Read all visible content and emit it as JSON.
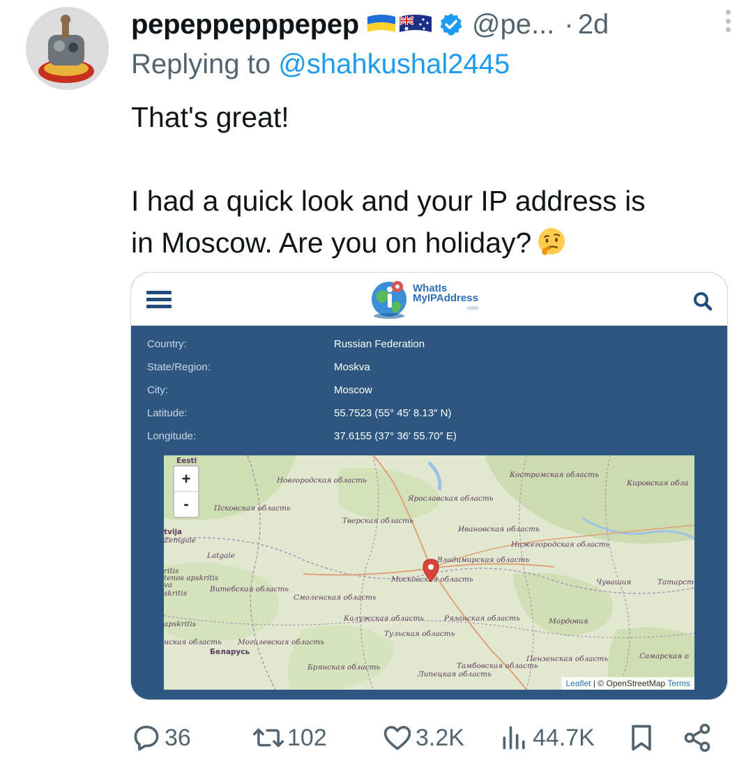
{
  "tweet": {
    "display_name": "pepeppepppepep",
    "handle": "@pe...",
    "separator": "·",
    "time": "2d",
    "replying_prefix": "Replying to ",
    "replying_to": "@shahkushal2445",
    "text_line1": "That's great!",
    "text_line2": "I had a quick look and your IP address is",
    "text_line3": "in Moscow. Are you on holiday?",
    "emoji": "thinking-face"
  },
  "card": {
    "logo_line1": "WhatIs",
    "logo_line2": "MyIPAddress",
    "logo_line3": ".com",
    "rows": [
      {
        "key": "Country:",
        "value": "Russian Federation"
      },
      {
        "key": "State/Region:",
        "value": "Moskva"
      },
      {
        "key": "City:",
        "value": "Moscow"
      },
      {
        "key": "Latitude:",
        "value": "55.7523 (55° 45′ 8.13″ N)"
      },
      {
        "key": "Longitude:",
        "value": "37.6155 (37° 36′ 55.70″ E)"
      }
    ],
    "map": {
      "zoom_in": "+",
      "zoom_out": "-",
      "labels": {
        "eesti": "Eesti",
        "novgorod": "Новгородская область",
        "kostroma": "Костромская область",
        "kirov": "Кировская обла",
        "yaroslavl": "Ярославская область",
        "pskov": "Псковская область",
        "tver": "Тверская область",
        "ivanovo": "Ивановская область",
        "nizhny": "Нижегородская область",
        "latvija": "tvija",
        "zemgale": "Zemgale",
        "latgale": "Latgale",
        "vladimir": "Владимирская область",
        "moscow_obl": "Московская область",
        "chuvash": "Чувашия",
        "tatar": "Татарст",
        "vitebsk": "Витебская область",
        "smolensk": "Смоленская область",
        "kaluga": "Калужская область",
        "ryazan": "Рязанская область",
        "mordovia": "Мордовия",
        "tula": "Тульская область",
        "mogilev": "Могилевская область",
        "belarus": "Беларусь",
        "bryansk": "Брянская область",
        "tambov": "Тамбовская область",
        "lipetsk": "Липецкая область",
        "penza": "Пензенская область",
        "samara": "Самарская о",
        "lt1": "ritis",
        "lt2": "tenos apskritis",
        "lt3": "va",
        "lt4": "skritis",
        "lt5": "apskritis",
        "lt6": "нская область"
      },
      "attribution_leaflet": "Leaflet",
      "attribution_sep": " | © ",
      "attribution_osm": "OpenStreetMap",
      "attribution_terms": "Terms"
    }
  },
  "actions": {
    "replies": "36",
    "reposts": "102",
    "likes": "3.2K",
    "views": "44.7K"
  },
  "colors": {
    "accent": "#1d9bf0",
    "muted": "#536471",
    "card_bg": "#2d5780",
    "verified": "#1d9bf0"
  }
}
